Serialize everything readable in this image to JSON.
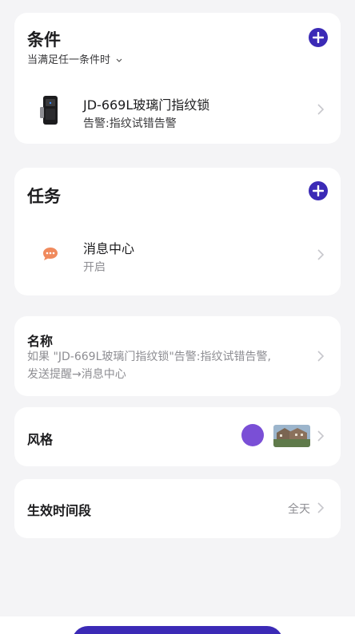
{
  "conditions": {
    "title": "条件",
    "subtitle": "当满足任一条件时",
    "item": {
      "name": "JD-669L玻璃门指纹锁",
      "detail": "告警:指纹试错告警",
      "icon": "fingerprint-lock-device-icon"
    }
  },
  "tasks": {
    "title": "任务",
    "item": {
      "name": "消息中心",
      "detail": "开启",
      "icon": "message-bubble-icon"
    }
  },
  "name_section": {
    "label": "名称",
    "line1": "如果 \"JD-669L玻璃门指纹锁\"告警:指纹试错告警,",
    "line2": "发送提醒→消息中心"
  },
  "style_section": {
    "label": "风格",
    "color": "#7a4fd6",
    "image_icon": "house-photo-thumbnail"
  },
  "time_section": {
    "label": "生效时间段",
    "value": "全天"
  },
  "colors": {
    "accent": "#3b2ab6",
    "message_icon": "#f08a5d"
  }
}
